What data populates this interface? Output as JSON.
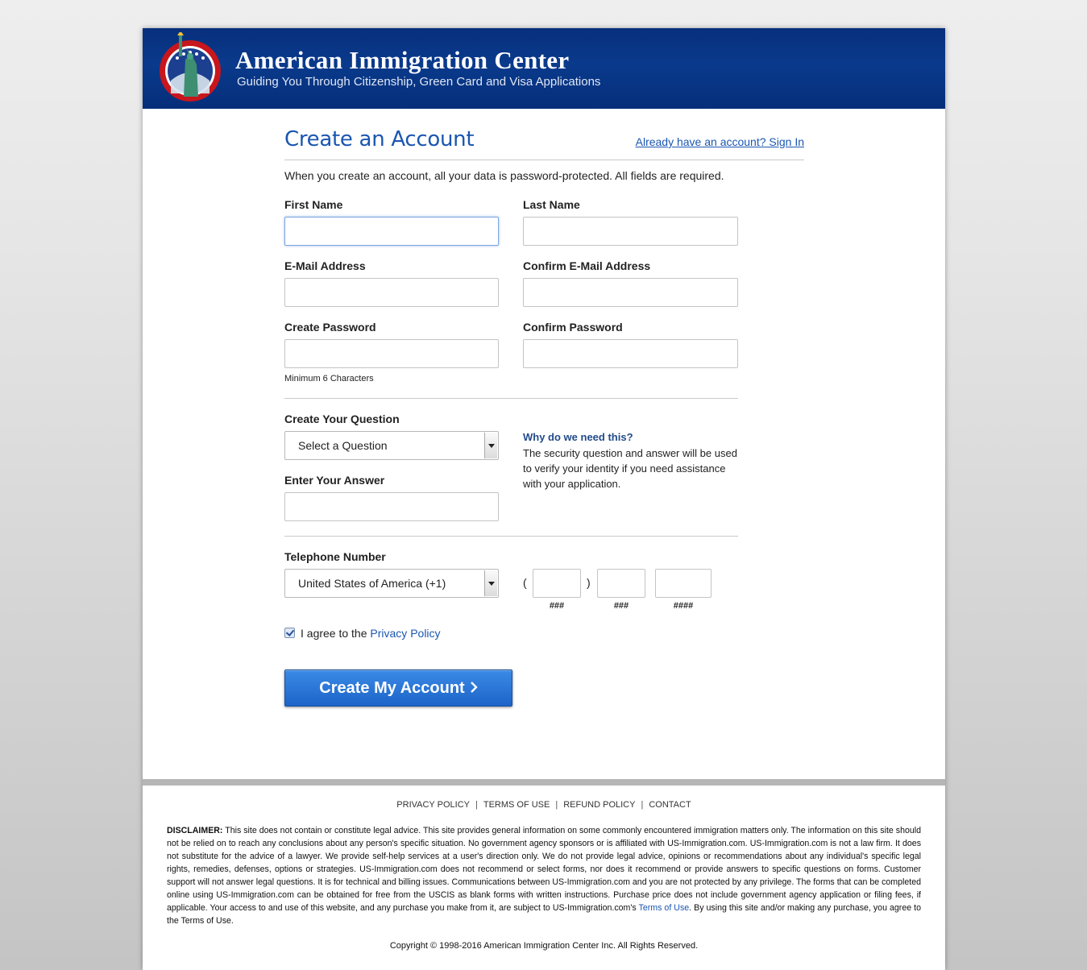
{
  "header": {
    "title": "American Immigration Center",
    "tagline": "Guiding You Through Citizenship, Green Card and Visa Applications",
    "logo_text": "AMERICAN IMMIGRATION CENTER"
  },
  "form": {
    "title": "Create an Account",
    "signin_link": "Already have an account? Sign In",
    "intro": "When you create an account, all your data is password-protected. All fields are required.",
    "first_name_label": "First Name",
    "last_name_label": "Last Name",
    "email_label": "E-Mail Address",
    "confirm_email_label": "Confirm E-Mail Address",
    "password_label": "Create Password",
    "confirm_password_label": "Confirm Password",
    "password_hint": "Minimum 6 Characters",
    "question_label": "Create Your Question",
    "question_selected": "Select a Question",
    "answer_label": "Enter Your Answer",
    "why_title": "Why do we need this?",
    "why_body": "The security question and answer will be used to verify your identity if you need assistance with your application.",
    "phone_label": "Telephone Number",
    "country_selected": "United States of America (+1)",
    "phone_open_paren": "(",
    "phone_close_paren": ")",
    "phone_hint_area": "###",
    "phone_hint_prefix": "###",
    "phone_hint_line": "####",
    "agree_text": "I agree to the",
    "privacy_link": "Privacy Policy",
    "agree_checked": true,
    "submit_label": "Create My Account"
  },
  "footer": {
    "links": [
      "PRIVACY POLICY",
      "TERMS OF USE",
      "REFUND POLICY",
      "CONTACT"
    ],
    "separator": "|",
    "disclaimer_label": "DISCLAIMER:",
    "disclaimer_body": "This site does not contain or constitute legal advice. This site provides general information on some commonly encountered immigration matters only. The information on this site should not be relied on to reach any conclusions about any person's specific situation. No government agency sponsors or is affiliated with US-Immigration.com. US-Immigration.com is not a law firm. It does not substitute for the advice of a lawyer. We provide self-help services at a user's direction only. We do not provide legal advice, opinions or recommendations about any individual's specific legal rights, remedies, defenses, options or strategies. US-Immigration.com does not recommend or select forms, nor does it recommend or provide answers to specific questions on forms. Customer support will not answer legal questions. It is for technical and billing issues. Communications between US-Immigration.com and you are not protected by any privilege. The forms that can be completed online using US-Immigration.com can be obtained for free from the USCIS as blank forms with written instructions. Purchase price does not include government agency application or filing fees, if applicable. Your access to and use of this website, and any purchase you make from it, are subject to US-Immigration.com's",
    "disclaimer_terms_link": "Terms of Use",
    "disclaimer_tail": ". By using this site and/or making any purchase, you agree to the Terms of Use.",
    "copyright": "Copyright © 1998-2016 American Immigration Center Inc. All Rights Reserved."
  },
  "colors": {
    "header_blue": "#0a3a8c",
    "link_blue": "#1a56b0",
    "button_blue": "#2a74d6"
  }
}
